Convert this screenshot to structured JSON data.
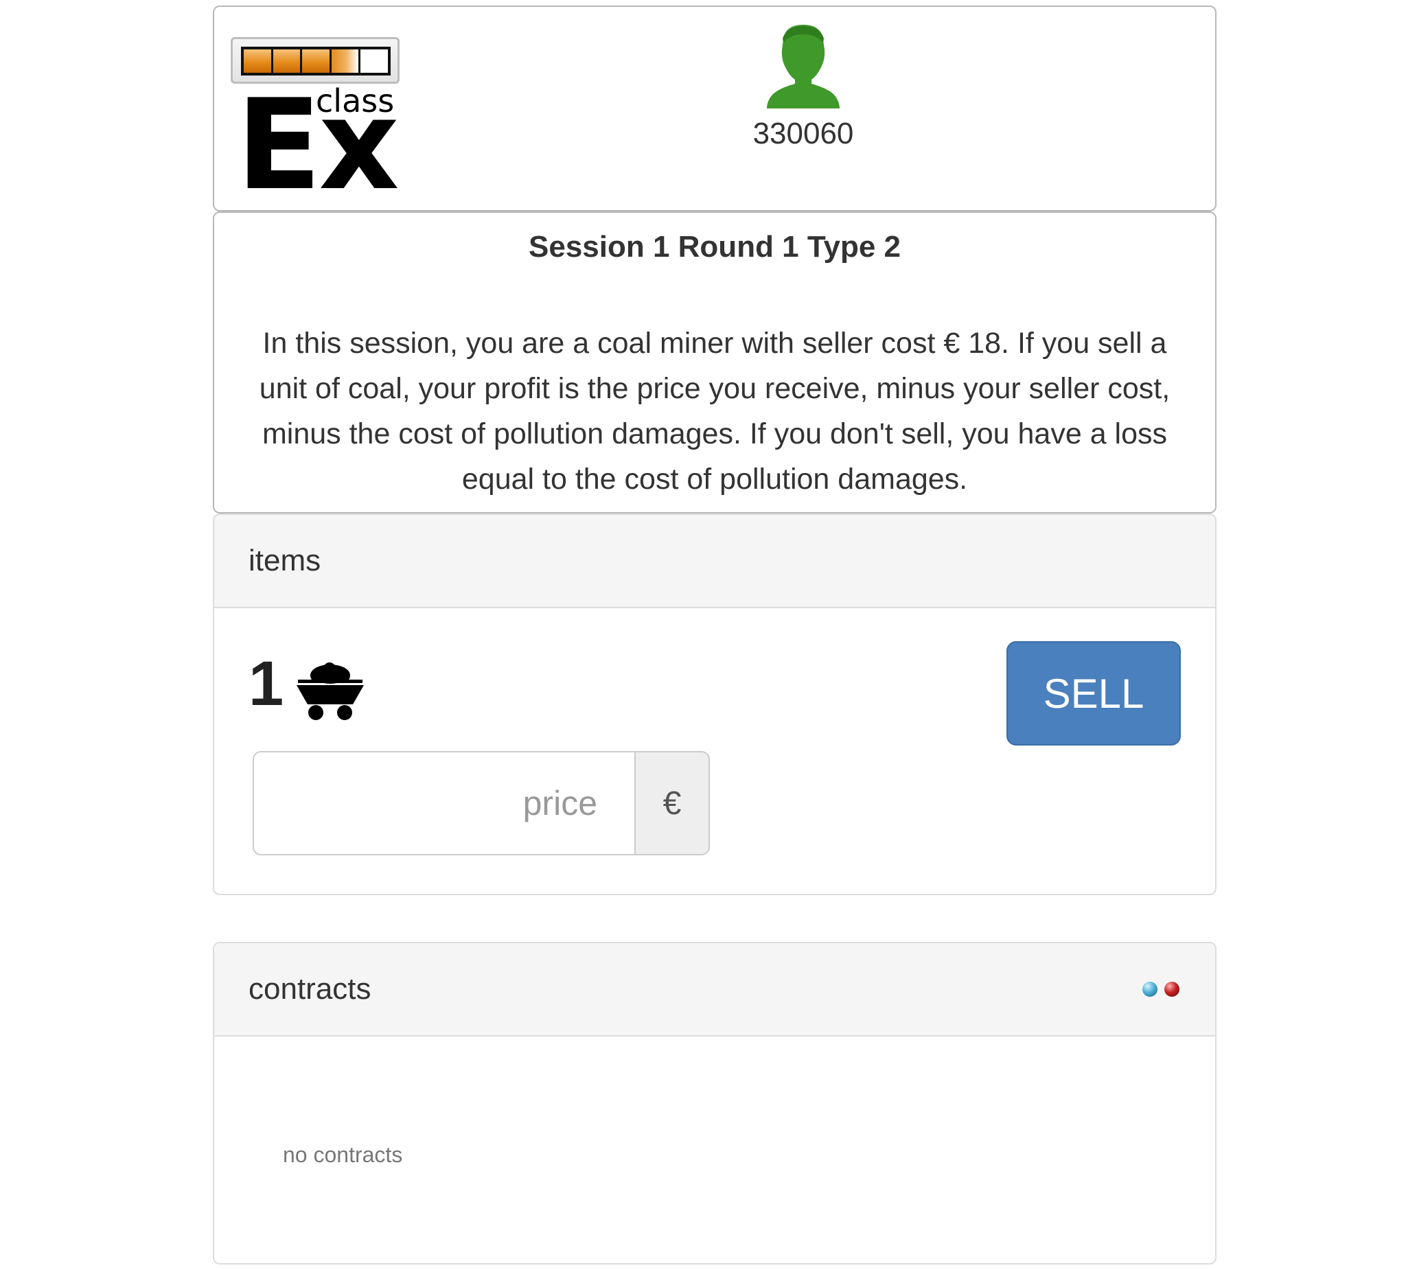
{
  "header": {
    "logo": {
      "brand_main": "Ex",
      "brand_sub": "class",
      "level_fill_fraction": 0.7,
      "level_segments": 5
    },
    "user": {
      "icon": "user-icon",
      "icon_color": "#3f9a2b",
      "id": "330060"
    }
  },
  "info": {
    "title": "Session 1 Round 1 Type 2",
    "text": "In this session, you are a coal miner with seller cost € 18. If you sell a unit of coal, your profit is the price you receive, minus your seller cost, minus the cost of pollution damages. If you don't sell, you have a loss equal to the cost of pollution damages."
  },
  "items": {
    "heading": "items",
    "quantity": "1",
    "item_icon": "coal-cart-icon",
    "sell_label": "SELL",
    "price_placeholder": "price",
    "price_value": "",
    "currency": "€",
    "accent_color": "#4a80bd"
  },
  "contracts": {
    "heading": "contracts",
    "status_icons": [
      "connection-status-blue-icon",
      "connection-status-red-icon"
    ],
    "empty_text": "no contracts"
  }
}
